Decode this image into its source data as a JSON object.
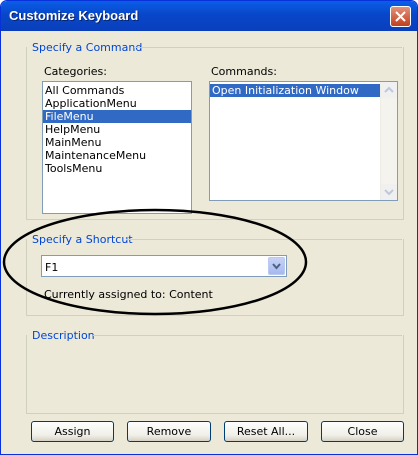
{
  "window": {
    "title": "Customize Keyboard"
  },
  "command_group": {
    "title": "Specify a Command",
    "categories_label": "Categories:",
    "commands_label": "Commands:",
    "categories": [
      {
        "label": "All Commands",
        "selected": false
      },
      {
        "label": "ApplicationMenu",
        "selected": false
      },
      {
        "label": "FileMenu",
        "selected": true
      },
      {
        "label": "HelpMenu",
        "selected": false
      },
      {
        "label": "MainMenu",
        "selected": false
      },
      {
        "label": "MaintenanceMenu",
        "selected": false
      },
      {
        "label": "ToolsMenu",
        "selected": false
      }
    ],
    "commands": [
      {
        "label": "Open Initialization Window",
        "selected": true
      }
    ]
  },
  "shortcut_group": {
    "title": "Specify a Shortcut",
    "shortcut_value": "F1",
    "assigned_text": "Currently assigned to: Content"
  },
  "description_group": {
    "title": "Description"
  },
  "buttons": {
    "assign": "Assign",
    "remove": "Remove",
    "reset_all": "Reset All...",
    "close": "Close"
  },
  "colors": {
    "titlebar": "#0a50d8",
    "group_label": "#0046d5",
    "selection": "#316ac5",
    "dialog_bg": "#ece9d8"
  }
}
